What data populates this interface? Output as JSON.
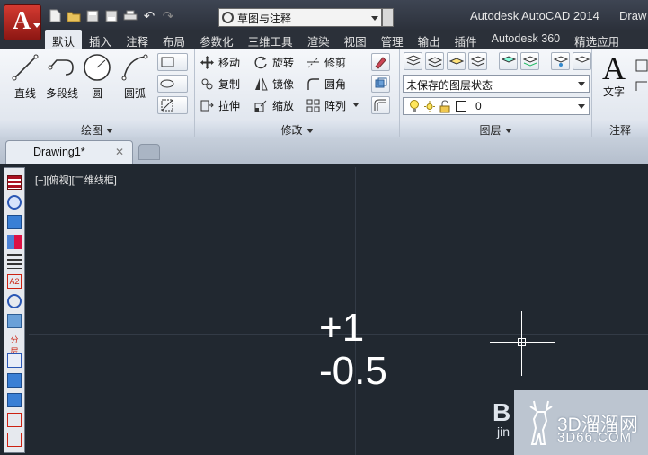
{
  "app": {
    "title": "Autodesk AutoCAD 2014",
    "title_overflow": "Draw"
  },
  "workspace": {
    "value": "草图与注释"
  },
  "qat": {
    "icons": [
      "new-icon",
      "open-icon",
      "save-icon",
      "saveas-icon",
      "plot-icon",
      "undo-icon",
      "redo-icon"
    ]
  },
  "tabs": [
    "默认",
    "插入",
    "注释",
    "布局",
    "参数化",
    "三维工具",
    "渲染",
    "视图",
    "管理",
    "输出",
    "插件",
    "Autodesk 360",
    "精选应用"
  ],
  "ribbon": {
    "draw": {
      "title": "绘图",
      "line": "直线",
      "polyline": "多段线",
      "circle": "圆",
      "arc": "圆弧"
    },
    "modify": {
      "title": "修改",
      "move": "移动",
      "rotate": "旋转",
      "trim": "修剪",
      "copy": "复制",
      "mirror": "镜像",
      "fillet": "圆角",
      "stretch": "拉伸",
      "scale": "缩放",
      "array": "阵列"
    },
    "layers": {
      "title": "图层",
      "state_combo": "未保存的图层状态",
      "layer_combo": "0"
    },
    "annotation": {
      "title": "注释",
      "text": "文字"
    }
  },
  "document": {
    "tab": "Drawing1*",
    "viewport_caption": "[−][俯视][二维线框]"
  },
  "overlay": {
    "line1": "+1",
    "line2": "-0.5"
  },
  "watermark": {
    "brand": "3D溜溜网",
    "url": "3D66.COM",
    "partial1": "B",
    "partial2": "jin"
  },
  "colors": {
    "accent": "#c9302c",
    "canvas": "#212830"
  }
}
